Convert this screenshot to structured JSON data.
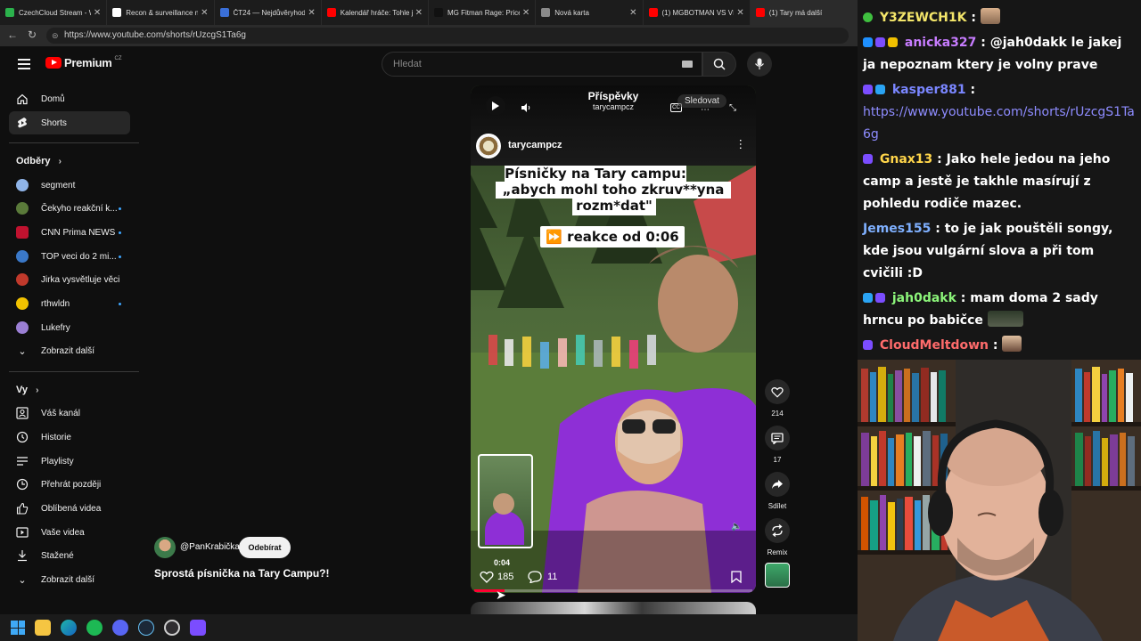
{
  "browser": {
    "tabs": [
      {
        "title": "CzechCloud Stream - W",
        "color": "#2bb24c"
      },
      {
        "title": "Recon & surveillance na",
        "color": "#ffffff"
      },
      {
        "title": "ČT24 — Nejdůvěryhodn",
        "color": "#3a6fd8"
      },
      {
        "title": "Kalendář hráče: Tohle jsq",
        "color": "#ff0000"
      },
      {
        "title": "MG Fitman Rage: Price P",
        "color": "#111111"
      },
      {
        "title": "Nová karta",
        "color": "#8a8a8a"
      },
      {
        "title": "(1) MGBOTMAN VS VIDF",
        "color": "#ff0000"
      },
      {
        "title": "(1) Tary má další",
        "color": "#ff0000"
      }
    ],
    "url": "https://www.youtube.com/shorts/rUzcgS1Ta6g"
  },
  "youtube": {
    "logo_text": "Premium",
    "logo_sup": "CZ",
    "search_placeholder": "Hledat",
    "sidebar": {
      "main": [
        {
          "label": "Domů",
          "icon": "home-icon"
        },
        {
          "label": "Shorts",
          "icon": "shorts-icon"
        }
      ],
      "subs_heading": "Odběry",
      "subs": [
        {
          "label": "segment",
          "color": "#8fb4e8",
          "dot": false
        },
        {
          "label": "Čekyho reakční k...",
          "color": "#5a7a3a",
          "dot": true
        },
        {
          "label": "CNN Prima NEWS",
          "color": "#c0122f",
          "dot": true
        },
        {
          "label": "TOP veci do 2 mi...",
          "color": "#3a78c8",
          "dot": true
        },
        {
          "label": "Jirka vysvětluje věci",
          "color": "#c0392b",
          "dot": false
        },
        {
          "label": "rthwldn",
          "color": "#f2c200",
          "dot": true
        },
        {
          "label": "Lukefry",
          "color": "#9b7fd4",
          "dot": false
        },
        {
          "label": "Zobrazit další",
          "color": "",
          "dot": false
        }
      ],
      "you_heading": "Vy",
      "you": [
        {
          "label": "Váš kanál",
          "icon": "channel-icon"
        },
        {
          "label": "Historie",
          "icon": "history-icon"
        },
        {
          "label": "Playlisty",
          "icon": "playlist-icon"
        },
        {
          "label": "Přehrát později",
          "icon": "clock-icon"
        },
        {
          "label": "Oblíbená videa",
          "icon": "thumbs-up-icon"
        },
        {
          "label": "Vaše videa",
          "icon": "video-icon"
        },
        {
          "label": "Stažené",
          "icon": "download-icon"
        },
        {
          "label": "Zobrazit další",
          "icon": "chevron-down-icon"
        }
      ]
    },
    "short": {
      "header_title": "Příspěvky",
      "header_channel": "tarycampcz",
      "follow_label": "Sledovat",
      "channel": "tarycampcz",
      "caption_line1": "Písničky na Tary campu:",
      "caption_line2": "„abych mohl toho zkruv**yna",
      "caption_line3": "rozm*dat\"",
      "reaction_label": "⏩ reakce od 0:06",
      "time": "0:04",
      "inner_likes": "185",
      "inner_comments": "11",
      "progress": 0.11
    },
    "actions": {
      "likes": "214",
      "comments": "17",
      "share": "Sdílet",
      "remix": "Remix"
    },
    "bottom": {
      "author": "@PanKrabička",
      "subscribe": "Odebírat",
      "title": "Sprostá písnička na Tary Campu?!"
    }
  },
  "chat": [
    {
      "user": "Y3ZEWCH1K",
      "color": "#f4e66a",
      "text": "",
      "badges": [
        "#3fbf3f"
      ],
      "emote": true
    },
    {
      "user": "anicka327",
      "color": "#c77cff",
      "text": "@jah0dakk le jakej ja nepoznam ktery je volny prave",
      "badges": [
        "#1e90ff",
        "#7b4dff",
        "#f0c000"
      ],
      "emote": false
    },
    {
      "user": "kasper881",
      "color": "#7a86ff",
      "text": "",
      "link": "https://www.youtube.com/shorts/rUzcgS1Ta6g",
      "badges": [
        "#7b4dff",
        "#2aa4f4"
      ],
      "emote": false
    },
    {
      "user": "Gnax13",
      "color": "#ffd54a",
      "text": "Jako hele jedou na jeho camp a jestě je takhle masírují z pohledu rodiče mazec.",
      "badges": [
        "#7b4dff"
      ],
      "emote": false
    },
    {
      "user": "Jemes155",
      "color": "#7fb0ff",
      "text": "to je jak pouštěli songy, kde jsou vulgární slova a při tom cvičili :D",
      "badges": [],
      "emote": false
    },
    {
      "user": "jah0dakk",
      "color": "#8cf57a",
      "text": "mam doma 2 sady hrncu po babičce",
      "badges": [
        "#2aa4f4",
        "#7b4dff"
      ],
      "emote": true
    },
    {
      "user": "CloudMeltdown",
      "color": "#ff6b6b",
      "text": "",
      "badges": [
        "#7b4dff"
      ],
      "emote": true
    }
  ],
  "taskbar": [
    "windows-icon",
    "explorer-icon",
    "edge-icon",
    "spotify-icon",
    "discord-icon",
    "steam-icon",
    "obs-icon",
    "app-icon"
  ]
}
